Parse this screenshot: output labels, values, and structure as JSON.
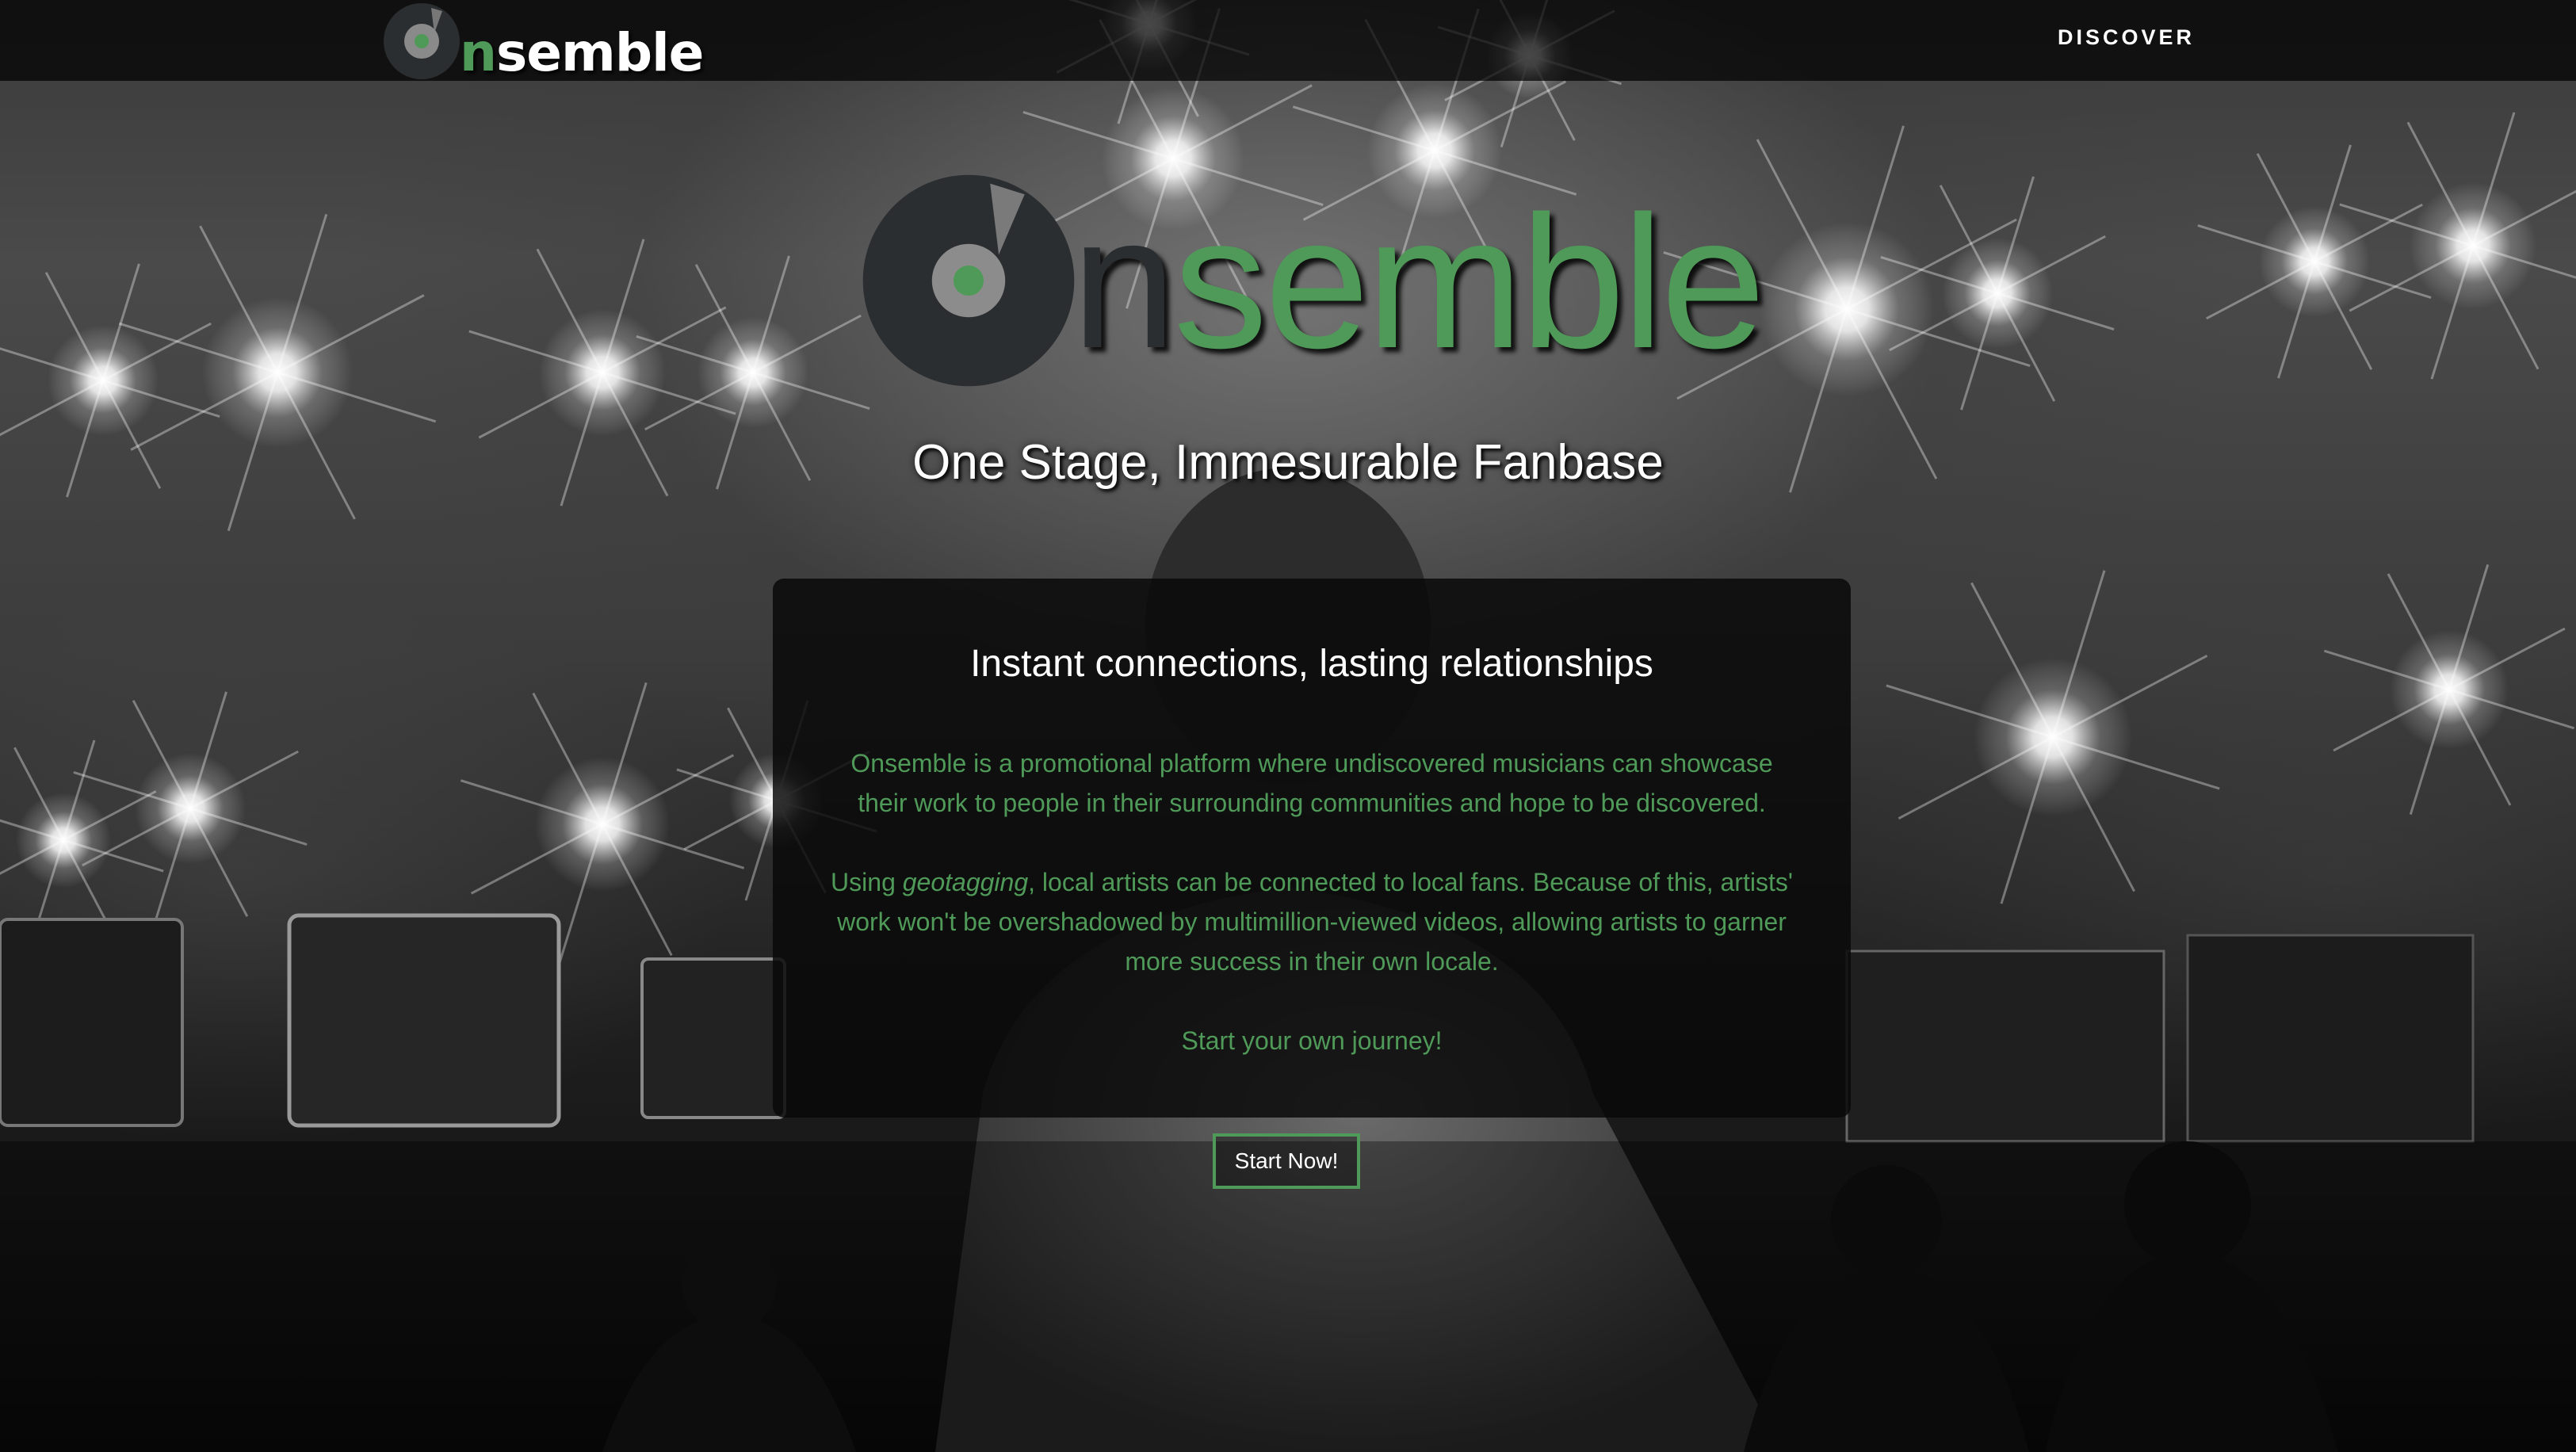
{
  "colors": {
    "accent_green": "#4f9a58",
    "dark_charcoal": "#2a2e30",
    "text_white": "#ffffff",
    "panel_bg": "#080808"
  },
  "nav": {
    "logo_letter_n": "n",
    "logo_rest": "semble",
    "discover_label": "DISCOVER"
  },
  "hero": {
    "logo_letter_n": "n",
    "logo_rest": "semble",
    "tagline": "One Stage, Immesurable Fanbase"
  },
  "panel": {
    "heading": "Instant connections, lasting relationships",
    "paragraph1": "Onsemble is a promotional platform where undiscovered musicians can showcase their work to people in their surrounding communities and hope to be discovered.",
    "paragraph2_prefix": "Using ",
    "paragraph2_emphasis": "geotagging",
    "paragraph2_suffix": ", local artists can be connected to local fans. Because of this, artists' work won't be overshadowed by multimillion-viewed videos, allowing artists to garner more success in their own locale.",
    "paragraph3": "Start your own journey!"
  },
  "cta": {
    "label": "Start Now!"
  },
  "icons": [
    "disc-logo-icon"
  ]
}
